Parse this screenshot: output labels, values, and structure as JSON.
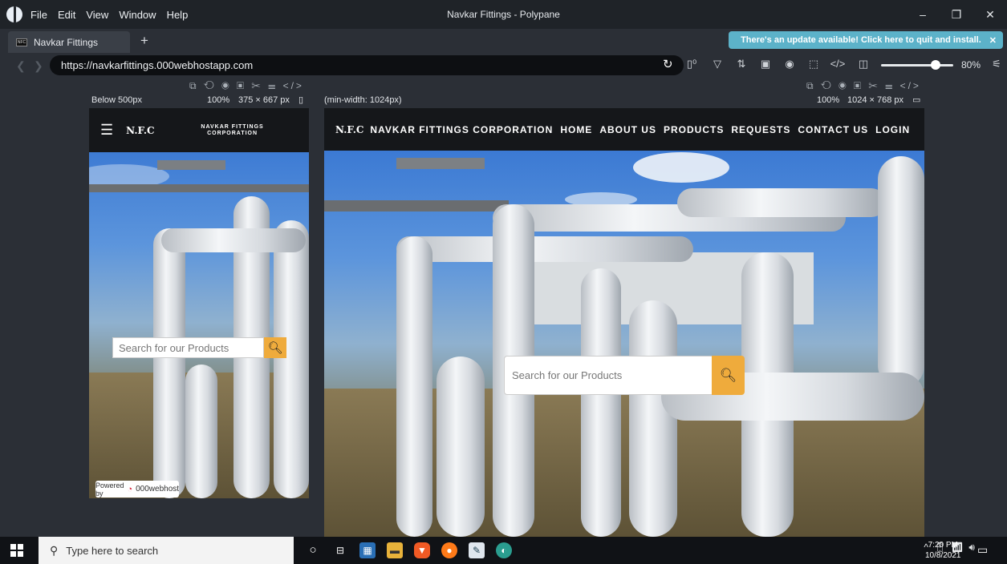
{
  "window": {
    "title": "Navkar Fittings - Polypane",
    "menu": [
      "File",
      "Edit",
      "View",
      "Window",
      "Help"
    ],
    "controls": {
      "minimize": "–",
      "restore": "❐",
      "close": "✕"
    }
  },
  "tabs": [
    {
      "label": "Navkar Fittings",
      "favicon": "NFC"
    }
  ],
  "new_tab": "+",
  "update_banner": {
    "text": "There's an update available! Click here to quit and install.",
    "close": "✕"
  },
  "address_bar": {
    "url": "https://navkarfittings.000webhostapp.com",
    "zoom": "80%"
  },
  "panes": {
    "mobile": {
      "label": "Below 500px",
      "scale": "100%",
      "size": "375 × 667 px",
      "site": {
        "brand": "N.F.C",
        "brand_full": "NAVKAR FITTINGS CORPORATION",
        "search_placeholder": "Search for our Products",
        "powered_by": "Powered by",
        "host": "000webhost"
      }
    },
    "desktop": {
      "label": "(min-width: 1024px)",
      "scale": "100%",
      "size": "1024 × 768 px",
      "site": {
        "brand": "N.F.C",
        "nav": [
          "NAVKAR FITTINGS CORPORATION",
          "HOME",
          "ABOUT US",
          "PRODUCTS",
          "REQUESTS",
          "CONTACT US",
          "LOGIN"
        ],
        "search_placeholder": "Search for our Products"
      }
    }
  },
  "taskbar": {
    "search_placeholder": "Type here to search",
    "time": "7:20 PM",
    "date": "10/8/2021"
  },
  "colors": {
    "accent": "#efab3c",
    "banner": "#5cb2c9"
  }
}
